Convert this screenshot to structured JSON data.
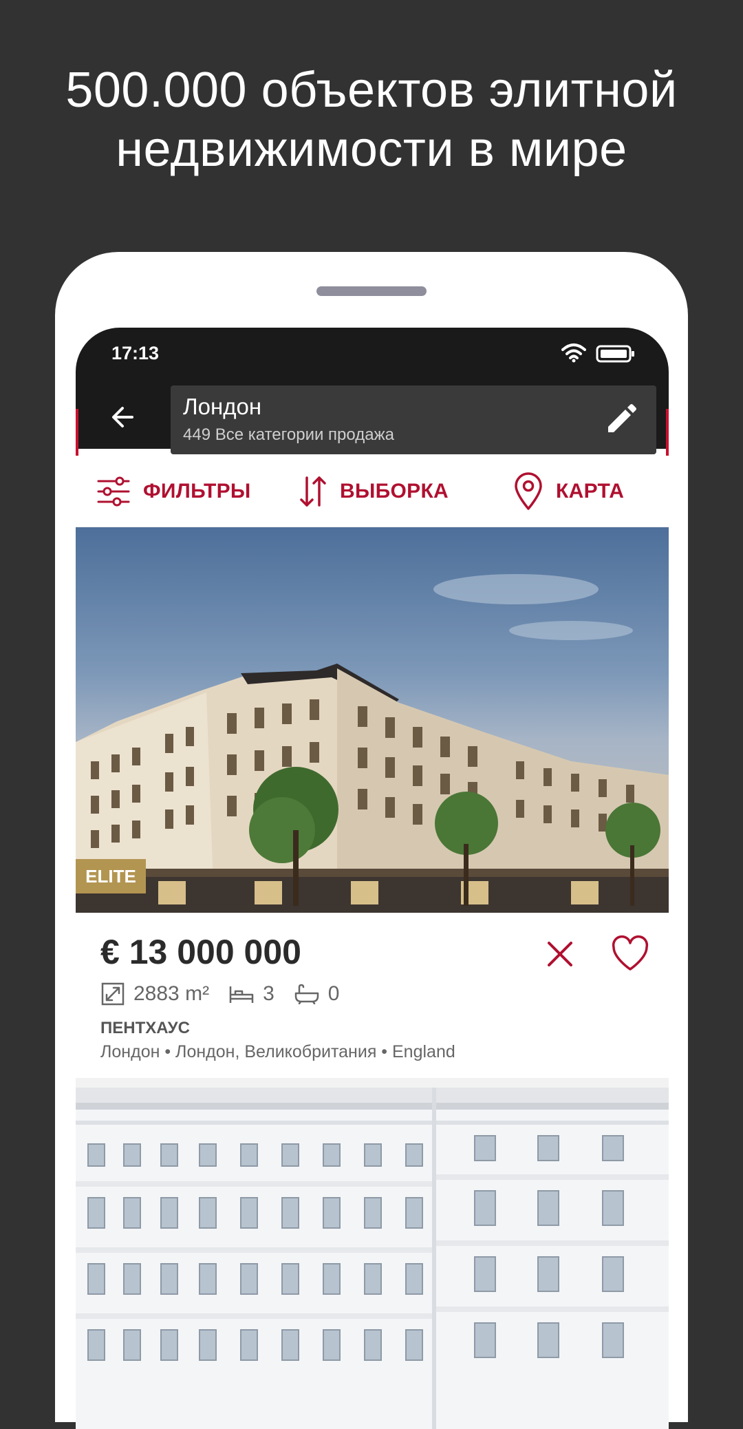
{
  "headline": {
    "line1": "500.000 объектов элитной",
    "line2": "недвижимости в мире"
  },
  "status_bar": {
    "time": "17:13"
  },
  "app_bar": {
    "search_title": "Лондон",
    "search_subtitle": "449 Все категории продажа"
  },
  "toolbar": {
    "filters_label": "ФИЛЬТРЫ",
    "sort_label": "ВЫБОРКА",
    "map_label": "КАРТА"
  },
  "listing": {
    "badge": "ELITE",
    "price": "€ 13 000 000",
    "area": "2883 m²",
    "bedrooms": "3",
    "bathrooms": "0",
    "type": "ПЕНТХАУС",
    "location": "Лондон • Лондон, Великобритания • England"
  },
  "colors": {
    "background": "#323232",
    "accent": "#b01030",
    "app_bar": "#1a1a1a",
    "elite_badge": "#b39552"
  },
  "icons": [
    "wifi-icon",
    "battery-icon",
    "back-arrow-icon",
    "edit-icon",
    "filters-icon",
    "sort-icon",
    "map-pin-icon",
    "close-icon",
    "heart-icon",
    "area-icon",
    "bed-icon",
    "bath-icon"
  ]
}
